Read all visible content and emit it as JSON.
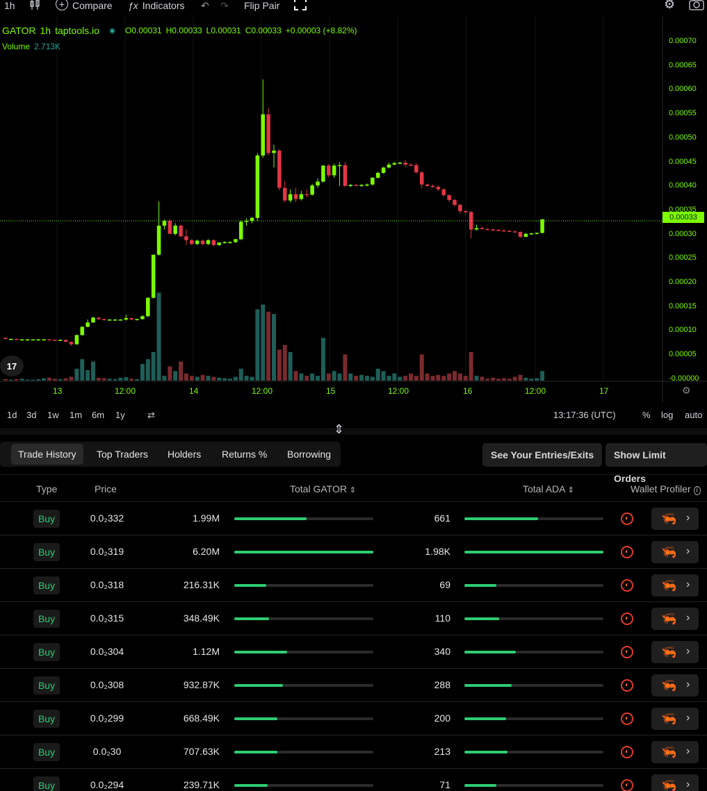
{
  "toolbar": {
    "interval": "1h",
    "compare": "Compare",
    "indicators": "Indicators",
    "flip_pair": "Flip Pair"
  },
  "legend": {
    "symbol": "GATOR",
    "interval": "1h",
    "source": "taptools.io",
    "o": "O0.00031",
    "h": "H0.00033",
    "l": "L0.00031",
    "c": "C0.00033",
    "change": "+0.00003 (+8.82%)",
    "volume_label": "Volume",
    "volume_value": "2.713K"
  },
  "price_scale": [
    "0.00070",
    "0.00065",
    "0.00060",
    "0.00055",
    "0.00050",
    "0.00045",
    "0.00040",
    "0.00035",
    "0.00030",
    "0.00025",
    "0.00020",
    "0.00015",
    "0.00010",
    "0.00005",
    "-0.00000"
  ],
  "current_price": "0.00033",
  "time_axis": [
    "13",
    "12:00",
    "14",
    "12:00",
    "15",
    "12:00",
    "16",
    "12:00",
    "17"
  ],
  "ranges": [
    "1d",
    "3d",
    "1w",
    "1m",
    "6m",
    "1y"
  ],
  "clock": "13:17:36 (UTC)",
  "scale_opts": {
    "pct": "%",
    "log": "log",
    "auto": "auto"
  },
  "tabs": [
    "Trade History",
    "Top Traders",
    "Holders",
    "Returns %",
    "Borrowing"
  ],
  "buttons": {
    "entries": "See Your Entries/Exits",
    "limit": "Show Limit Orders"
  },
  "table": {
    "headers": {
      "type": "Type",
      "price": "Price",
      "gator": "Total GATOR",
      "ada": "Total ADA",
      "wallet": "Wallet Profiler"
    },
    "rows": [
      {
        "type": "Buy",
        "price": "0.0₂332",
        "gator": "1.99M",
        "gator_frac": 0.52,
        "ada": "661",
        "ada_frac": 0.53
      },
      {
        "type": "Buy",
        "price": "0.0₂319",
        "gator": "6.20M",
        "gator_frac": 1.0,
        "ada": "1.98K",
        "ada_frac": 1.0
      },
      {
        "type": "Buy",
        "price": "0.0₂318",
        "gator": "216.31K",
        "gator_frac": 0.23,
        "ada": "69",
        "ada_frac": 0.23
      },
      {
        "type": "Buy",
        "price": "0.0₂315",
        "gator": "348.49K",
        "gator_frac": 0.25,
        "ada": "110",
        "ada_frac": 0.25
      },
      {
        "type": "Buy",
        "price": "0.0₂304",
        "gator": "1.12M",
        "gator_frac": 0.38,
        "ada": "340",
        "ada_frac": 0.37
      },
      {
        "type": "Buy",
        "price": "0.0₂308",
        "gator": "932.87K",
        "gator_frac": 0.35,
        "ada": "288",
        "ada_frac": 0.34
      },
      {
        "type": "Buy",
        "price": "0.0₂299",
        "gator": "668.49K",
        "gator_frac": 0.31,
        "ada": "200",
        "ada_frac": 0.3
      },
      {
        "type": "Buy",
        "price": "0.0₂30",
        "gator": "707.63K",
        "gator_frac": 0.31,
        "ada": "213",
        "ada_frac": 0.31
      },
      {
        "type": "Buy",
        "price": "0.0₂294",
        "gator": "239.71K",
        "gator_frac": 0.24,
        "ada": "71",
        "ada_frac": 0.23
      }
    ]
  },
  "colors": {
    "up": "#7cfc00",
    "down": "#e23645",
    "accent": "#2ecc71"
  },
  "chart_data": {
    "type": "candlestick",
    "ylim": [
      0,
      0.0007
    ],
    "candles": [
      {
        "o": 8.8e-05,
        "h": 8.9e-05,
        "l": 8.5e-05,
        "c": 8.6e-05,
        "v": 0.003
      },
      {
        "o": 8.6e-05,
        "h": 8.7e-05,
        "l": 8.5e-05,
        "c": 8.6e-05,
        "v": 0.002
      },
      {
        "o": 8.6e-05,
        "h": 8.7e-05,
        "l": 8.4e-05,
        "c": 8.5e-05,
        "v": 0.003
      },
      {
        "o": 8.5e-05,
        "h": 8.6e-05,
        "l": 8.4e-05,
        "c": 8.5e-05,
        "v": 0.004
      },
      {
        "o": 8.5e-05,
        "h": 8.6e-05,
        "l": 8.4e-05,
        "c": 8.5e-05,
        "v": 0.002
      },
      {
        "o": 8.5e-05,
        "h": 8.6e-05,
        "l": 8.4e-05,
        "c": 8.5e-05,
        "v": 0.002
      },
      {
        "o": 8.5e-05,
        "h": 8.6e-05,
        "l": 8.4e-05,
        "c": 8.5e-05,
        "v": 0.003
      },
      {
        "o": 8.5e-05,
        "h": 8.6e-05,
        "l": 8.4e-05,
        "c": 8.5e-05,
        "v": 0.005
      },
      {
        "o": 8.5e-05,
        "h": 8.6e-05,
        "l": 8.3e-05,
        "c": 8.4e-05,
        "v": 0.006
      },
      {
        "o": 8.4e-05,
        "h": 8.5e-05,
        "l": 8.2e-05,
        "c": 8.3e-05,
        "v": 0.004
      },
      {
        "o": 8.3e-05,
        "h": 8.5e-05,
        "l": 8.2e-05,
        "c": 8.4e-05,
        "v": 0.003
      },
      {
        "o": 8.4e-05,
        "h": 8.5e-05,
        "l": 8e-05,
        "c": 8e-05,
        "v": 0.005
      },
      {
        "o": 8e-05,
        "h": 8.1e-05,
        "l": 7.2e-05,
        "c": 7.5e-05,
        "v": 0.008
      },
      {
        "o": 7.5e-05,
        "h": 9.5e-05,
        "l": 7.4e-05,
        "c": 9.4e-05,
        "v": 0.025
      },
      {
        "o": 9.4e-05,
        "h": 0.000112,
        "l": 9.3e-05,
        "c": 0.000111,
        "v": 0.045
      },
      {
        "o": 0.000111,
        "h": 0.000126,
        "l": 0.00011,
        "c": 0.00012,
        "v": 0.022
      },
      {
        "o": 0.00012,
        "h": 0.000132,
        "l": 0.000119,
        "c": 0.00013,
        "v": 0.04
      },
      {
        "o": 0.00013,
        "h": 0.000131,
        "l": 0.000125,
        "c": 0.000127,
        "v": 0.006
      },
      {
        "o": 0.000127,
        "h": 0.000128,
        "l": 0.000124,
        "c": 0.000125,
        "v": 0.005
      },
      {
        "o": 0.000125,
        "h": 0.000127,
        "l": 0.000124,
        "c": 0.000126,
        "v": 0.004
      },
      {
        "o": 0.000126,
        "h": 0.000127,
        "l": 0.000125,
        "c": 0.000126,
        "v": 0.003
      },
      {
        "o": 0.000126,
        "h": 0.000127,
        "l": 0.000125,
        "c": 0.000126,
        "v": 0.006
      },
      {
        "o": 0.000126,
        "h": 0.000136,
        "l": 0.000124,
        "c": 0.000129,
        "v": 0.007
      },
      {
        "o": 0.000129,
        "h": 0.00013,
        "l": 0.000125,
        "c": 0.000126,
        "v": 0.004
      },
      {
        "o": 0.000126,
        "h": 0.000128,
        "l": 0.000124,
        "c": 0.000127,
        "v": 0.003
      },
      {
        "o": 0.000127,
        "h": 0.000135,
        "l": 0.000126,
        "c": 0.000133,
        "v": 0.035
      },
      {
        "o": 0.000133,
        "h": 0.000172,
        "l": 0.000131,
        "c": 0.000171,
        "v": 0.045
      },
      {
        "o": 0.000171,
        "h": 0.00026,
        "l": 0.000169,
        "c": 0.00026,
        "v": 0.06
      },
      {
        "o": 0.00026,
        "h": 0.00037,
        "l": 0.000258,
        "c": 0.00032,
        "v": 0.185
      },
      {
        "o": 0.00032,
        "h": 0.000332,
        "l": 0.000312,
        "c": 0.00033,
        "v": 0.01
      },
      {
        "o": 0.00033,
        "h": 0.000333,
        "l": 0.000302,
        "c": 0.000303,
        "v": 0.03
      },
      {
        "o": 0.000303,
        "h": 0.000325,
        "l": 0.0003,
        "c": 0.00032,
        "v": 0.02
      },
      {
        "o": 0.00032,
        "h": 0.000322,
        "l": 0.000296,
        "c": 0.000298,
        "v": 0.04
      },
      {
        "o": 0.000298,
        "h": 0.000312,
        "l": 0.00028,
        "c": 0.00029,
        "v": 0.015
      },
      {
        "o": 0.00029,
        "h": 0.000293,
        "l": 0.00028,
        "c": 0.000282,
        "v": 0.01
      },
      {
        "o": 0.000282,
        "h": 0.000291,
        "l": 0.00028,
        "c": 0.000289,
        "v": 0.008
      },
      {
        "o": 0.000289,
        "h": 0.000291,
        "l": 0.00028,
        "c": 0.000282,
        "v": 0.012
      },
      {
        "o": 0.000282,
        "h": 0.000292,
        "l": 0.00028,
        "c": 0.00029,
        "v": 0.01
      },
      {
        "o": 0.00029,
        "h": 0.000292,
        "l": 0.000277,
        "c": 0.00028,
        "v": 0.008
      },
      {
        "o": 0.00028,
        "h": 0.000286,
        "l": 0.000278,
        "c": 0.000285,
        "v": 0.006
      },
      {
        "o": 0.000285,
        "h": 0.000288,
        "l": 0.000283,
        "c": 0.000286,
        "v": 0.005
      },
      {
        "o": 0.000286,
        "h": 0.000288,
        "l": 0.000283,
        "c": 0.000286,
        "v": 0.004
      },
      {
        "o": 0.000286,
        "h": 0.000293,
        "l": 0.000284,
        "c": 0.000292,
        "v": 0.008
      },
      {
        "o": 0.000292,
        "h": 0.00033,
        "l": 0.00029,
        "c": 0.000328,
        "v": 0.025
      },
      {
        "o": 0.000328,
        "h": 0.000335,
        "l": 0.00032,
        "c": 0.00033,
        "v": 0.01
      },
      {
        "o": 0.00033,
        "h": 0.000338,
        "l": 0.000325,
        "c": 0.000336,
        "v": 0.008
      },
      {
        "o": 0.000336,
        "h": 0.00047,
        "l": 0.00033,
        "c": 0.000465,
        "v": 0.15
      },
      {
        "o": 0.000465,
        "h": 0.000622,
        "l": 0.00046,
        "c": 0.00055,
        "v": 0.16
      },
      {
        "o": 0.00055,
        "h": 0.000563,
        "l": 0.000465,
        "c": 0.00047,
        "v": 0.145
      },
      {
        "o": 0.00047,
        "h": 0.000487,
        "l": 0.00044,
        "c": 0.000475,
        "v": 0.14
      },
      {
        "o": 0.000475,
        "h": 0.000478,
        "l": 0.000393,
        "c": 0.000398,
        "v": 0.065
      },
      {
        "o": 0.000398,
        "h": 0.000412,
        "l": 0.000368,
        "c": 0.000372,
        "v": 0.075
      },
      {
        "o": 0.000372,
        "h": 0.000395,
        "l": 0.000368,
        "c": 0.000385,
        "v": 0.06
      },
      {
        "o": 0.000385,
        "h": 0.000398,
        "l": 0.000368,
        "c": 0.000375,
        "v": 0.02
      },
      {
        "o": 0.000375,
        "h": 0.000392,
        "l": 0.000372,
        "c": 0.000385,
        "v": 0.015
      },
      {
        "o": 0.000385,
        "h": 0.000395,
        "l": 0.000378,
        "c": 0.000384,
        "v": 0.01
      },
      {
        "o": 0.000384,
        "h": 0.000406,
        "l": 0.000382,
        "c": 0.000403,
        "v": 0.015
      },
      {
        "o": 0.000403,
        "h": 0.000418,
        "l": 0.000398,
        "c": 0.000411,
        "v": 0.01
      },
      {
        "o": 0.000411,
        "h": 0.000445,
        "l": 0.000409,
        "c": 0.000444,
        "v": 0.09
      },
      {
        "o": 0.000444,
        "h": 0.000447,
        "l": 0.00042,
        "c": 0.000424,
        "v": 0.015
      },
      {
        "o": 0.000424,
        "h": 0.000448,
        "l": 0.000419,
        "c": 0.000444,
        "v": 0.02
      },
      {
        "o": 0.000444,
        "h": 0.000451,
        "l": 0.000402,
        "c": 0.000445,
        "v": 0.015
      },
      {
        "o": 0.000445,
        "h": 0.000452,
        "l": 0.0004,
        "c": 0.000402,
        "v": 0.055
      },
      {
        "o": 0.000402,
        "h": 0.000406,
        "l": 0.0004,
        "c": 0.000404,
        "v": 0.015
      },
      {
        "o": 0.000404,
        "h": 0.000406,
        "l": 0.000402,
        "c": 0.000403,
        "v": 0.01
      },
      {
        "o": 0.000403,
        "h": 0.000406,
        "l": 0.0004,
        "c": 0.000404,
        "v": 0.012
      },
      {
        "o": 0.000404,
        "h": 0.000407,
        "l": 0.000401,
        "c": 0.000405,
        "v": 0.01
      },
      {
        "o": 0.000405,
        "h": 0.00042,
        "l": 0.000403,
        "c": 0.000419,
        "v": 0.008
      },
      {
        "o": 0.000419,
        "h": 0.000431,
        "l": 0.000417,
        "c": 0.000429,
        "v": 0.025
      },
      {
        "o": 0.000429,
        "h": 0.000441,
        "l": 0.000427,
        "c": 0.00044,
        "v": 0.02
      },
      {
        "o": 0.00044,
        "h": 0.00045,
        "l": 0.000438,
        "c": 0.000446,
        "v": 0.01
      },
      {
        "o": 0.000446,
        "h": 0.000452,
        "l": 0.000445,
        "c": 0.000449,
        "v": 0.015
      },
      {
        "o": 0.000449,
        "h": 0.000452,
        "l": 0.000447,
        "c": 0.00045,
        "v": 0.008
      },
      {
        "o": 0.00045,
        "h": 0.000456,
        "l": 0.000441,
        "c": 0.000446,
        "v": 0.01
      },
      {
        "o": 0.000446,
        "h": 0.000449,
        "l": 0.000443,
        "c": 0.000445,
        "v": 0.015
      },
      {
        "o": 0.000445,
        "h": 0.000449,
        "l": 0.000428,
        "c": 0.00043,
        "v": 0.01
      },
      {
        "o": 0.00043,
        "h": 0.000433,
        "l": 0.000397,
        "c": 0.000405,
        "v": 0.055
      },
      {
        "o": 0.000405,
        "h": 0.000407,
        "l": 0.0004,
        "c": 0.000402,
        "v": 0.015
      },
      {
        "o": 0.000402,
        "h": 0.000405,
        "l": 0.000398,
        "c": 0.0004,
        "v": 0.01
      },
      {
        "o": 0.0004,
        "h": 0.000403,
        "l": 0.000392,
        "c": 0.000395,
        "v": 0.012
      },
      {
        "o": 0.000395,
        "h": 0.000397,
        "l": 0.00038,
        "c": 0.000383,
        "v": 0.01
      },
      {
        "o": 0.000383,
        "h": 0.000385,
        "l": 0.000369,
        "c": 0.000373,
        "v": 0.015
      },
      {
        "o": 0.000373,
        "h": 0.000375,
        "l": 0.00036,
        "c": 0.000363,
        "v": 0.02
      },
      {
        "o": 0.000363,
        "h": 0.000365,
        "l": 0.000345,
        "c": 0.00035,
        "v": 0.015
      },
      {
        "o": 0.00035,
        "h": 0.000352,
        "l": 0.000345,
        "c": 0.000348,
        "v": 0.01
      },
      {
        "o": 0.000348,
        "h": 0.00035,
        "l": 0.000294,
        "c": 0.000312,
        "v": 0.06
      },
      {
        "o": 0.000312,
        "h": 0.000322,
        "l": 0.00031,
        "c": 0.000315,
        "v": 0.01
      },
      {
        "o": 0.000315,
        "h": 0.000318,
        "l": 0.000312,
        "c": 0.000313,
        "v": 0.008
      },
      {
        "o": 0.000313,
        "h": 0.000315,
        "l": 0.000311,
        "c": 0.000312,
        "v": 0.004
      },
      {
        "o": 0.000312,
        "h": 0.000314,
        "l": 0.00031,
        "c": 0.000311,
        "v": 0.006
      },
      {
        "o": 0.000311,
        "h": 0.000313,
        "l": 0.000309,
        "c": 0.00031,
        "v": 0.004
      },
      {
        "o": 0.00031,
        "h": 0.000312,
        "l": 0.000308,
        "c": 0.000309,
        "v": 0.005
      },
      {
        "o": 0.000309,
        "h": 0.000311,
        "l": 0.000307,
        "c": 0.000308,
        "v": 0.004
      },
      {
        "o": 0.000308,
        "h": 0.00031,
        "l": 0.000306,
        "c": 0.000307,
        "v": 0.008
      },
      {
        "o": 0.000307,
        "h": 0.000308,
        "l": 0.000295,
        "c": 0.000297,
        "v": 0.012
      },
      {
        "o": 0.000297,
        "h": 0.000305,
        "l": 0.000296,
        "c": 0.000303,
        "v": 0.006
      },
      {
        "o": 0.000303,
        "h": 0.000305,
        "l": 0.000301,
        "c": 0.000304,
        "v": 0.004
      },
      {
        "o": 0.000304,
        "h": 0.000306,
        "l": 0.000302,
        "c": 0.000305,
        "v": 0.005
      },
      {
        "o": 0.000305,
        "h": 0.000334,
        "l": 0.000304,
        "c": 0.000333,
        "v": 0.02
      }
    ]
  }
}
